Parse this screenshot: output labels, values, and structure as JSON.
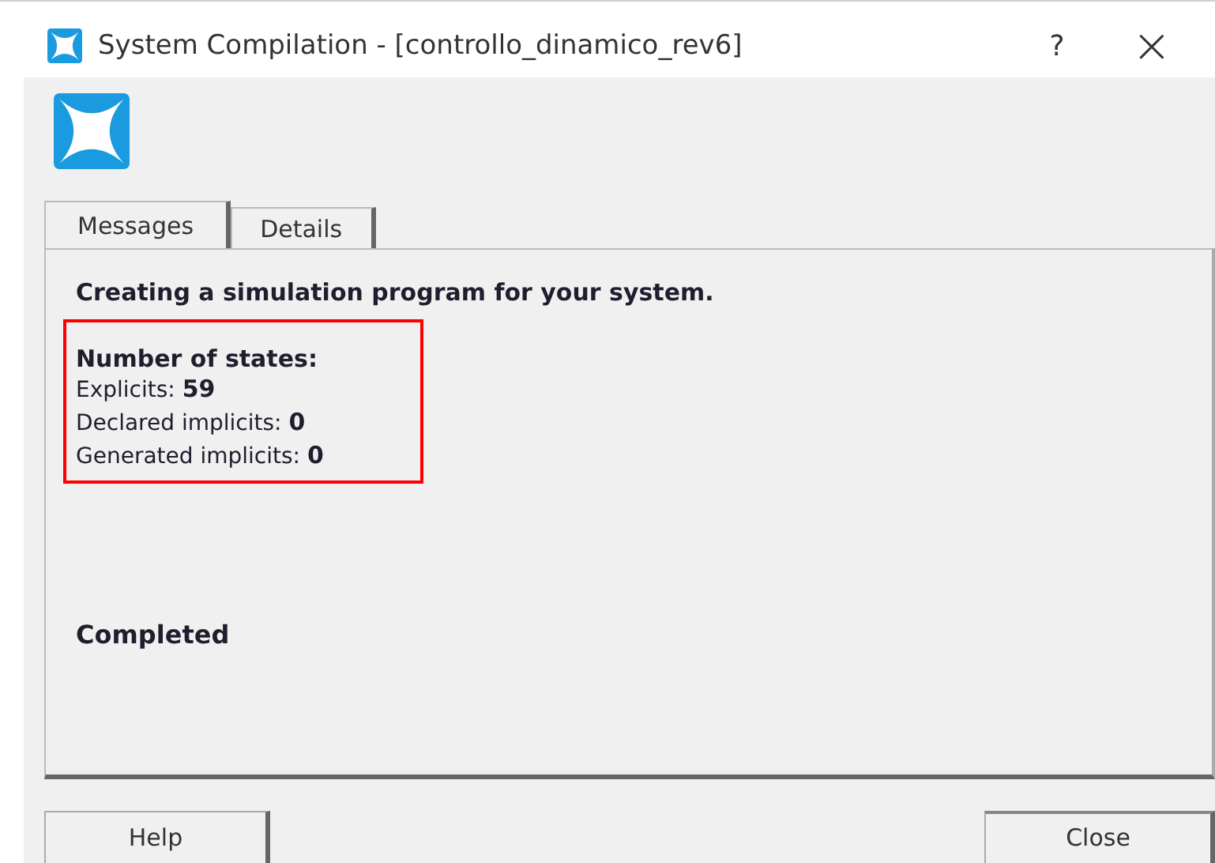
{
  "window": {
    "title": "System Compilation - [controllo_dinamico_rev6]",
    "help": "?",
    "close": "×"
  },
  "tabs": [
    {
      "label": "Messages",
      "selected": true
    },
    {
      "label": "Details",
      "selected": false
    }
  ],
  "messages": {
    "heading": "Creating a simulation program for your system.",
    "states_title": "Number of states:",
    "states": [
      "Explicits: **59**",
      "Declared implicits: **0**",
      "Generated implicits: **0**"
    ],
    "highlighted": true,
    "status": "Completed"
  },
  "buttons": [
    {
      "label": "Help",
      "kind": "help"
    },
    {
      "label": "Close",
      "kind": "close"
    }
  ]
}
